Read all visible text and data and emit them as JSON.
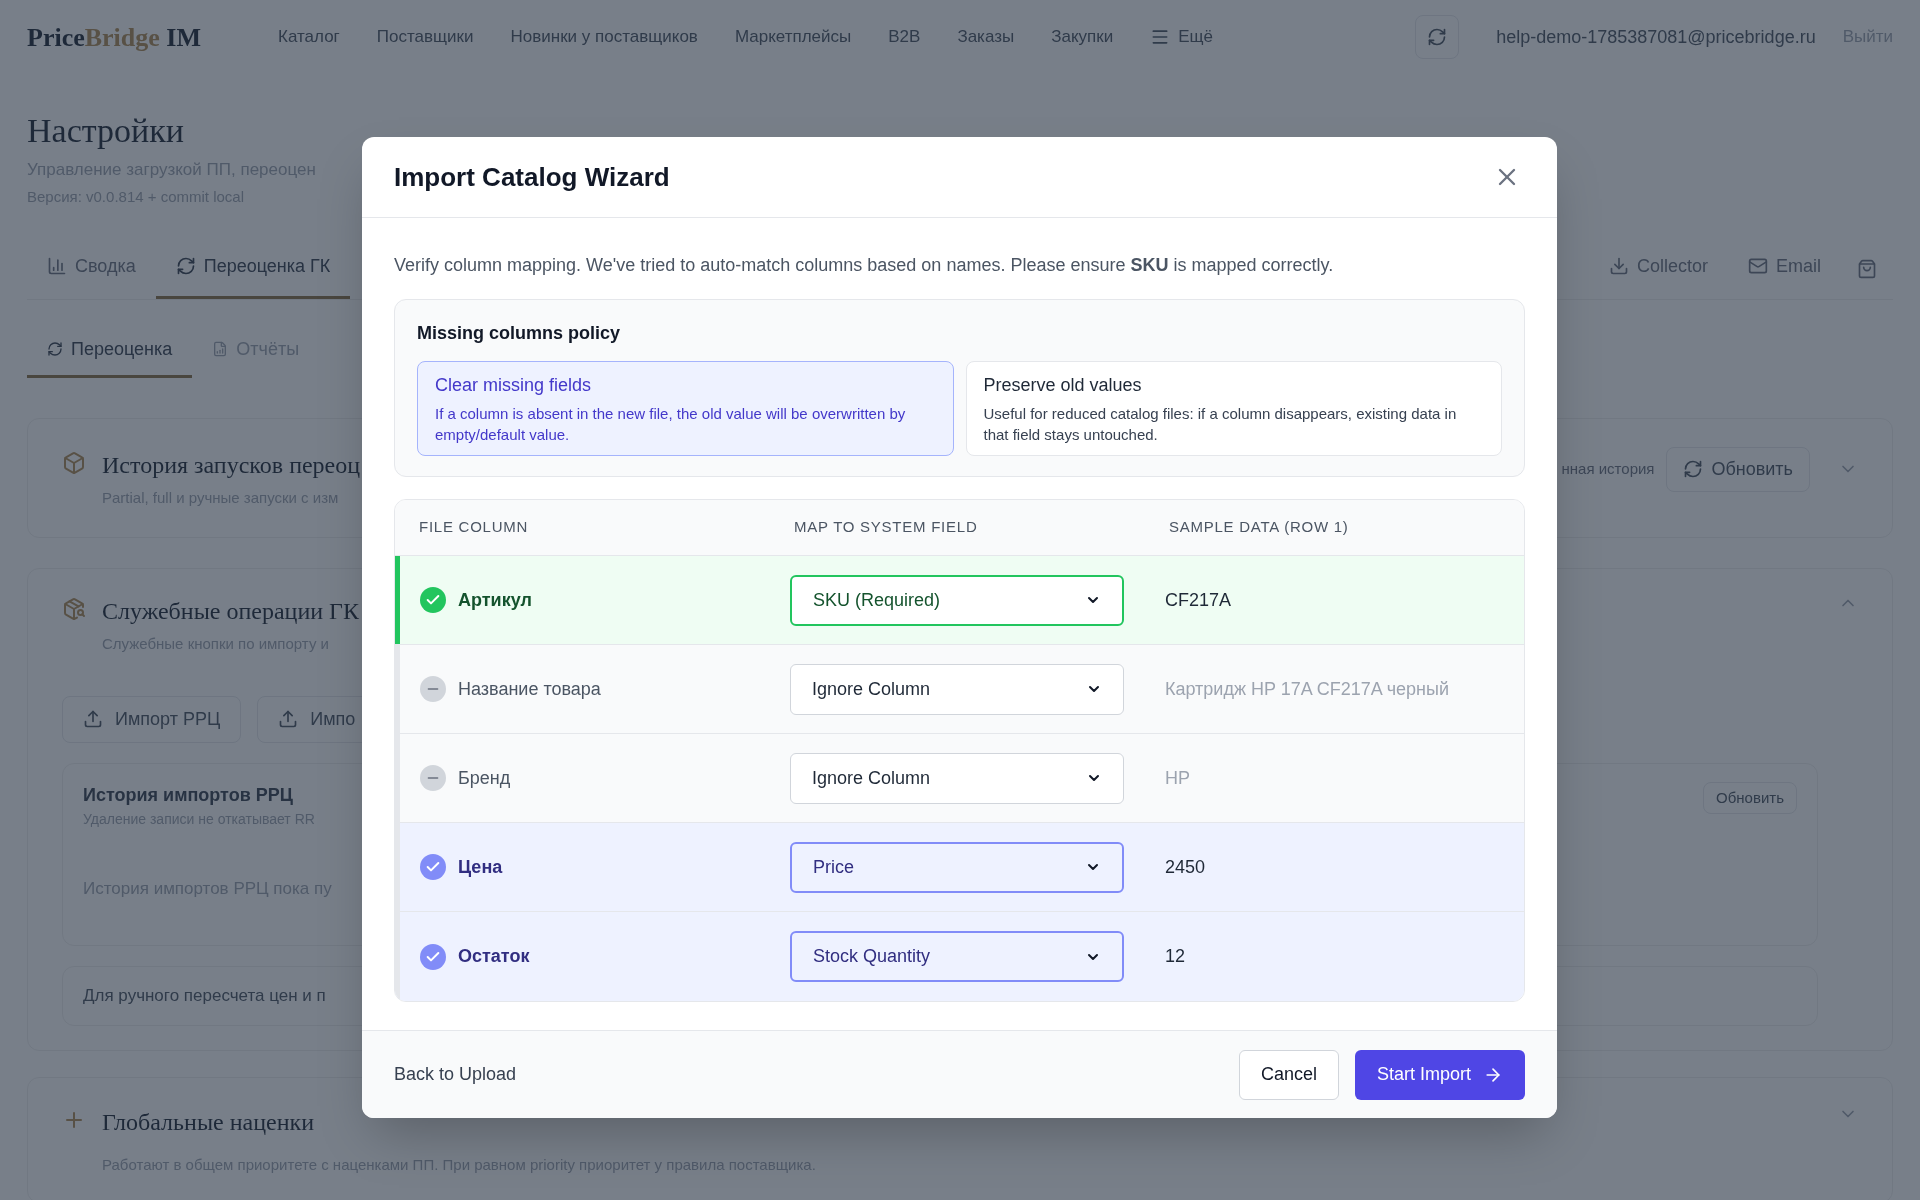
{
  "nav": {
    "logo": [
      "Price",
      "Bridge",
      "IM"
    ],
    "items": [
      "Каталог",
      "Поставщики",
      "Новинки у поставщиков",
      "Маркетплейсы",
      "B2B",
      "Заказы",
      "Закупки"
    ],
    "more": "Ещё",
    "user_email": "help-demo-1785387081@pricebridge.ru",
    "logout": "Выйти"
  },
  "page": {
    "title": "Настройки",
    "subtitle": "Управление загрузкой ПП, переоцен",
    "version": "Версия: v0.0.814 + commit local"
  },
  "tabs_left": [
    {
      "label": "Сводка",
      "selected": false
    },
    {
      "label": "Переоценка ГК",
      "selected": true
    }
  ],
  "tabs_right": [
    {
      "label": "Collector",
      "selected": false
    },
    {
      "label": "Email",
      "selected": false
    }
  ],
  "subtabs": [
    {
      "label": "Переоценка",
      "selected": true
    },
    {
      "label": "Отчёты",
      "selected": false
    }
  ],
  "runs_card": {
    "title": "История запусков переоц",
    "subtitle": "Partial, full и ручные запуски с изм",
    "side_note": "нная история",
    "refresh": "Обновить",
    "expanded": false
  },
  "service_card": {
    "title": "Служебные операции ГК",
    "subtitle": "Служебные кнопки по импорту и",
    "expanded": true,
    "buttons": [
      "Импорт РРЦ",
      "Импо"
    ],
    "history": {
      "title": "История импортов РРЦ",
      "subtitle": "Удаление записи не откатывает RR",
      "empty": "История импортов РРЦ пока пу",
      "refresh": "Обновить"
    },
    "manual_note": "Для ручного пересчета цен и п"
  },
  "markups_card": {
    "title": "Глобальные наценки",
    "subtitle": "Работают в общем приоритете с наценками ПП. При равном priority приоритет у правила поставщика.",
    "expanded": false
  },
  "modal": {
    "title": "Import Catalog Wizard",
    "description": "Verify column mapping. We've tried to auto-match columns based on names. Please ensure **SKU** is mapped correctly.",
    "policy": {
      "title": "Missing columns policy",
      "options": [
        {
          "title": "Clear missing fields",
          "description": "If a column is absent in the new file, the old value will be overwritten by empty/default value.",
          "selected": true
        },
        {
          "title": "Preserve old values",
          "description": "Useful for reduced catalog files: if a column disappears, existing data in that field stays untouched.",
          "selected": false
        }
      ]
    },
    "columns": [
      "FILE COLUMN",
      "MAP TO SYSTEM FIELD",
      "SAMPLE DATA (ROW 1)"
    ],
    "rows": [
      {
        "file_column": "Артикул",
        "mapping": "SKU (Required)",
        "sample": "CF217A",
        "kind": "required"
      },
      {
        "file_column": "Название товара",
        "mapping": "Ignore Column",
        "sample": "Картридж HP 17A CF217A черный",
        "kind": "ignored"
      },
      {
        "file_column": "Бренд",
        "mapping": "Ignore Column",
        "sample": "HP",
        "kind": "ignored"
      },
      {
        "file_column": "Цена",
        "mapping": "Price",
        "sample": "2450",
        "kind": "mapped"
      },
      {
        "file_column": "Остаток",
        "mapping": "Stock Quantity",
        "sample": "12",
        "kind": "mapped"
      }
    ],
    "back": "Back to Upload",
    "cancel": "Cancel",
    "start": "Start Import"
  }
}
